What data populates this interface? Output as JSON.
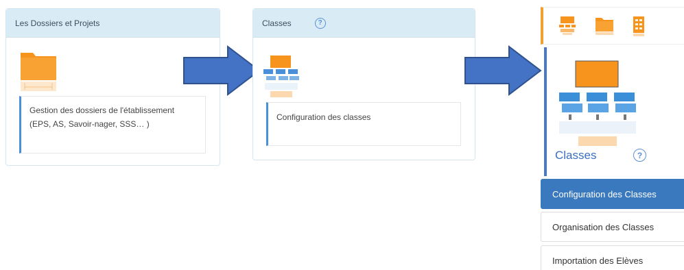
{
  "card1": {
    "header": "Les Dossiers et Projets",
    "link": "Gestion des dossiers de l'établissement (EPS, AS, Savoir-nager, SSS… )"
  },
  "card2": {
    "header": "Classes",
    "help": "?",
    "link": "Configuration des classes"
  },
  "right": {
    "title": "Classes",
    "help": "?",
    "menu": [
      {
        "label": "Configuration des Classes"
      },
      {
        "label": "Organisation des Classes"
      },
      {
        "label": "Importation des Elèves"
      }
    ]
  },
  "colors": {
    "arrow": "#4472c4",
    "folder": "#f7941d",
    "accent": "#4a90d9",
    "active": "#3a79bd"
  },
  "icons": {
    "card1": "folder-icon",
    "card2": "classroom-icon",
    "bar": [
      "classroom-icon",
      "folder-icon",
      "building-icon"
    ],
    "big": "classroom-icon"
  }
}
